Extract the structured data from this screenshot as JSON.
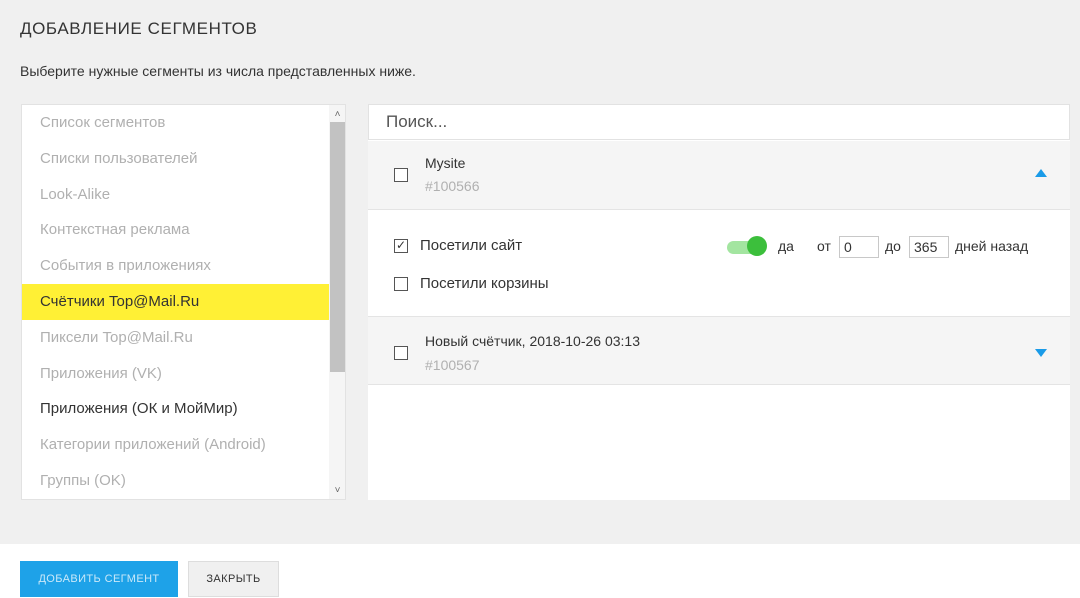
{
  "dialog": {
    "title": "ДОБАВЛЕНИЕ СЕГМЕНТОВ",
    "subtitle": "Выберите нужные сегменты из числа представленных ниже."
  },
  "categories": [
    {
      "label": "Список сегментов",
      "state": "inactive"
    },
    {
      "label": "Списки пользователей",
      "state": "inactive"
    },
    {
      "label": "Look-Alike",
      "state": "inactive"
    },
    {
      "label": "Контекстная реклама",
      "state": "inactive"
    },
    {
      "label": "События в приложениях",
      "state": "inactive"
    },
    {
      "label": "Счётчики Top@Mail.Ru",
      "state": "selected"
    },
    {
      "label": "Пиксели Top@Mail.Ru",
      "state": "inactive"
    },
    {
      "label": "Приложения (VK)",
      "state": "inactive"
    },
    {
      "label": "Приложения (ОК и МойМир)",
      "state": "dark"
    },
    {
      "label": "Категории приложений (Android)",
      "state": "inactive"
    },
    {
      "label": "Группы (OK)",
      "state": "inactive"
    }
  ],
  "scroll": {
    "up_glyph": "˄",
    "down_glyph": "˅"
  },
  "search": {
    "placeholder": "Поиск..."
  },
  "segments": [
    {
      "name": "Mysite",
      "id": "#100566",
      "checked": false,
      "expanded": true,
      "rules": [
        {
          "label": "Посетили сайт",
          "checked": true,
          "toggle_on": true,
          "toggle_label": "да",
          "from_label": "от",
          "from_value": "0",
          "to_label": "до",
          "to_value": "365",
          "suffix": "дней назад"
        },
        {
          "label": "Посетили корзины",
          "checked": false
        }
      ]
    },
    {
      "name": "Новый счётчик, 2018-10-26 03:13",
      "id": "#100567",
      "checked": false,
      "expanded": false
    }
  ],
  "glyphs": {
    "check": "✓"
  },
  "footer": {
    "add_label": "ДОБАВИТЬ СЕГМЕНТ",
    "close_label": "ЗАКРЫТЬ"
  },
  "colors": {
    "accent": "#1ea2e8",
    "selected_bg": "#fff035",
    "toggle_on": "#3cbf3c"
  }
}
